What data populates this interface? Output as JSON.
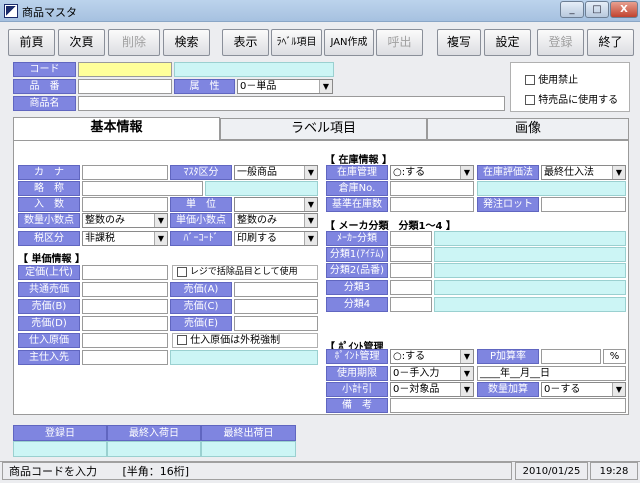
{
  "window": {
    "title": "商品マスタ",
    "btn_min": "_",
    "btn_max": "□",
    "btn_close": "X"
  },
  "toolbar": {
    "prev": "前頁",
    "next": "次頁",
    "delete": "削除",
    "search": "検索",
    "display": "表示",
    "label_item": "ﾗﾍﾞﾙ項目",
    "jan": "JAN作成",
    "call": "呼出",
    "copy": "複写",
    "settings": "設定",
    "register": "登録",
    "end": "終了"
  },
  "header": {
    "code_label": "コード",
    "code_value": "",
    "hinban_label": "品　番",
    "attr_label": "属　性",
    "attr_value": "0－単品",
    "name_label": "商品名",
    "disable_label": "使用禁止",
    "special_label": "特売品に使用する"
  },
  "tabs": {
    "basic": "基本情報",
    "label": "ラベル項目",
    "image": "画像"
  },
  "basic": {
    "kana": "カ　ナ",
    "master_kubun": "ﾏｽﾀ区分",
    "master_value": "一般商品",
    "ryaku": "略　称",
    "irisu": "入　数",
    "tani": "単　位",
    "tani_value": "",
    "qty_dec": "数量小数点",
    "qty_dec_value": "整数のみ",
    "price_dec": "単価小数点",
    "price_dec_value": "整数のみ",
    "tax": "税区分",
    "tax_value": "非課税",
    "barcode": "ﾊﾞｰｺｰﾄﾞ",
    "barcode_value": "印刷する",
    "price_section": "【 単価情報 】",
    "teika": "定価(上代)",
    "regi_exclude": "レジで括除品目として使用",
    "kyotsu": "共通売価",
    "baika_a": "売価(A)",
    "baika_b": "売価(B)",
    "baika_c": "売価(C)",
    "baika_d": "売価(D)",
    "baika_e": "売価(E)",
    "shiire": "仕入原価",
    "shiire_tax": "仕入原価は外税強制",
    "shiiresaki": "主仕入先"
  },
  "stock": {
    "section": "【 在庫情報 】",
    "kanri": "在庫管理",
    "kanri_value": "○:する",
    "hyoka": "在庫評価法",
    "hyoka_value": "最終仕入法",
    "soko": "倉庫No.",
    "kijun": "基準在庫数",
    "hacchu": "発注ロット"
  },
  "maker": {
    "section": "【 メーカ分類　分類1～4 】",
    "maker": "ﾒｰｶｰ分類",
    "b1": "分類1(ｱｲﾃﾑ)",
    "b2": "分類2(品番)",
    "b3": "分類3",
    "b4": "分類4"
  },
  "point": {
    "section": "【 ﾎﾟｲﾝﾄ管理",
    "kanri": "ﾎﾟｲﾝﾄ管理",
    "kanri_value": "○:する",
    "rate": "P加算率",
    "pct": "%",
    "kigen": "使用期限",
    "kigen_value": "0－手入力",
    "date_value": "____年__月__日",
    "shokei": "小計引",
    "shokei_value": "0－対象品",
    "qty_add": "数量加算",
    "qty_add_value": "0－する",
    "biko": "備　考"
  },
  "footer_table": {
    "headers": [
      "登録日",
      "最終入荷日",
      "最終出荷日"
    ]
  },
  "status": {
    "message": "商品コードを入力",
    "hint": "[半角：16桁]",
    "date": "2010/01/25",
    "time": "19:28"
  }
}
